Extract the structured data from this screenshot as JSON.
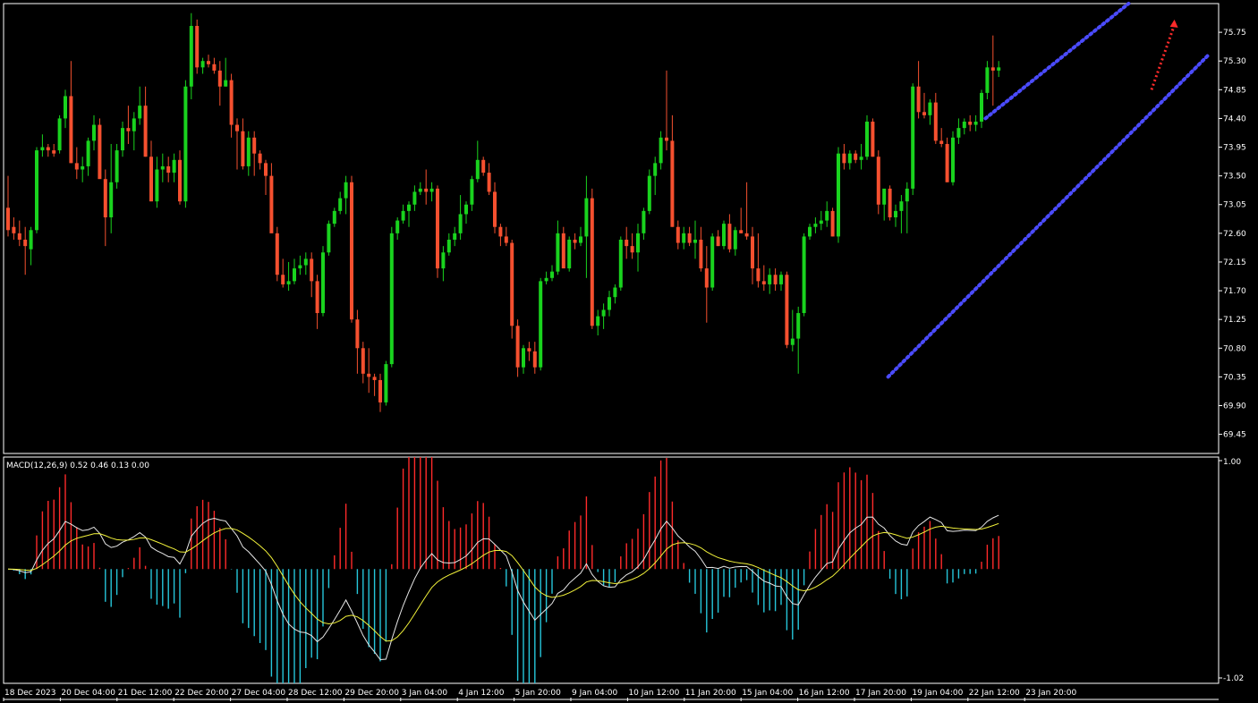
{
  "chart_data": {
    "type": "candlestick",
    "colors": {
      "background": "#000000",
      "frame": "#ffffff",
      "bull_candle": "#19d31e",
      "bear_candle": "#f5502f",
      "wick_bull": "#19d31e",
      "wick_bear": "#f5502f",
      "macd_hist_positive": "#ff2a2a",
      "macd_hist_negative": "#26c6da",
      "macd_line": "#e6e6e6",
      "signal_line": "#f2f23a",
      "channel_line": "#4b4bff",
      "arrow": "#ff2a2a"
    },
    "price_axis": {
      "ticks": [
        "75.75",
        "75.30",
        "74.85",
        "74.40",
        "73.95",
        "73.50",
        "73.05",
        "72.60",
        "72.15",
        "71.70",
        "71.25",
        "70.80",
        "70.35",
        "69.90",
        "69.45"
      ],
      "ylim": [
        69.15,
        76.2
      ]
    },
    "time_axis": {
      "labels": [
        "18 Dec 2023",
        "20 Dec 04:00",
        "21 Dec 12:00",
        "22 Dec 20:00",
        "27 Dec 04:00",
        "28 Dec 12:00",
        "29 Dec 20:00",
        "3 Jan 04:00",
        "4 Jan 12:00",
        "5 Jan 20:00",
        "9 Jan 04:00",
        "10 Jan 12:00",
        "11 Jan 20:00",
        "15 Jan 04:00",
        "16 Jan 12:00",
        "17 Jan 20:00",
        "19 Jan 04:00",
        "22 Jan 12:00",
        "23 Jan 20:00"
      ]
    },
    "candles": [
      [
        73.0,
        73.5,
        72.55,
        72.65
      ],
      [
        72.7,
        72.85,
        72.5,
        72.6
      ],
      [
        72.6,
        72.8,
        72.4,
        72.5
      ],
      [
        72.5,
        72.7,
        71.95,
        72.4
      ],
      [
        72.35,
        72.7,
        72.1,
        72.65
      ],
      [
        72.65,
        73.95,
        72.6,
        73.9
      ],
      [
        73.9,
        74.15,
        73.8,
        73.95
      ],
      [
        73.95,
        74.0,
        73.8,
        73.9
      ],
      [
        73.9,
        74.0,
        73.8,
        73.85
      ],
      [
        73.9,
        74.45,
        73.85,
        74.4
      ],
      [
        74.4,
        74.85,
        74.25,
        74.75
      ],
      [
        74.75,
        75.3,
        73.7,
        73.7
      ],
      [
        73.7,
        73.95,
        73.45,
        73.6
      ],
      [
        73.6,
        73.8,
        73.4,
        73.65
      ],
      [
        73.65,
        74.1,
        73.5,
        74.05
      ],
      [
        74.05,
        74.45,
        73.9,
        74.3
      ],
      [
        74.3,
        74.4,
        73.6,
        73.45
      ],
      [
        73.45,
        73.6,
        72.4,
        72.85
      ],
      [
        72.85,
        74.0,
        72.6,
        73.4
      ],
      [
        73.4,
        74.0,
        73.3,
        73.9
      ],
      [
        73.9,
        74.35,
        73.8,
        74.25
      ],
      [
        74.25,
        74.6,
        74.0,
        74.2
      ],
      [
        74.2,
        74.5,
        73.9,
        74.4
      ],
      [
        74.4,
        74.9,
        74.3,
        74.6
      ],
      [
        74.6,
        74.9,
        73.8,
        73.8
      ],
      [
        73.8,
        74.05,
        73.1,
        73.1
      ],
      [
        73.1,
        73.8,
        73.0,
        73.6
      ],
      [
        73.6,
        73.85,
        73.4,
        73.65
      ],
      [
        73.65,
        73.8,
        73.4,
        73.55
      ],
      [
        73.55,
        73.85,
        73.4,
        73.75
      ],
      [
        73.75,
        73.9,
        73.05,
        73.1
      ],
      [
        73.1,
        75.0,
        73.0,
        74.9
      ],
      [
        74.9,
        76.05,
        74.7,
        75.85
      ],
      [
        75.85,
        75.95,
        75.1,
        75.2
      ],
      [
        75.2,
        75.35,
        75.1,
        75.3
      ],
      [
        75.3,
        75.4,
        75.2,
        75.25
      ],
      [
        75.25,
        75.35,
        75.1,
        75.15
      ],
      [
        75.15,
        75.3,
        74.6,
        74.9
      ],
      [
        74.9,
        75.35,
        74.9,
        75.0
      ],
      [
        75.0,
        75.1,
        74.1,
        74.3
      ],
      [
        74.3,
        74.4,
        73.6,
        74.2
      ],
      [
        74.2,
        74.4,
        73.6,
        73.65
      ],
      [
        73.65,
        74.2,
        73.5,
        74.1
      ],
      [
        74.1,
        74.2,
        73.5,
        73.85
      ],
      [
        73.85,
        73.9,
        73.6,
        73.7
      ],
      [
        73.7,
        73.75,
        73.2,
        73.5
      ],
      [
        73.5,
        73.7,
        72.65,
        72.6
      ],
      [
        72.6,
        72.7,
        71.85,
        71.95
      ],
      [
        71.95,
        72.2,
        71.75,
        71.8
      ],
      [
        71.8,
        72.15,
        71.7,
        71.85
      ],
      [
        71.85,
        72.2,
        71.8,
        72.05
      ],
      [
        72.05,
        72.25,
        71.95,
        72.1
      ],
      [
        72.1,
        72.3,
        71.95,
        72.2
      ],
      [
        72.2,
        72.3,
        71.6,
        71.85
      ],
      [
        71.85,
        71.95,
        71.1,
        71.35
      ],
      [
        71.35,
        72.4,
        71.3,
        72.3
      ],
      [
        72.3,
        72.8,
        72.25,
        72.75
      ],
      [
        72.75,
        73.0,
        72.7,
        72.95
      ],
      [
        72.95,
        73.25,
        72.9,
        73.15
      ],
      [
        73.15,
        73.5,
        72.9,
        73.4
      ],
      [
        73.4,
        73.5,
        71.2,
        71.25
      ],
      [
        71.25,
        71.4,
        70.4,
        70.8
      ],
      [
        70.8,
        70.9,
        70.25,
        70.4
      ],
      [
        70.4,
        70.8,
        70.1,
        70.35
      ],
      [
        70.35,
        70.4,
        70.05,
        70.3
      ],
      [
        70.3,
        70.4,
        69.8,
        69.95
      ],
      [
        69.95,
        70.6,
        69.9,
        70.55
      ],
      [
        70.55,
        72.7,
        70.5,
        72.6
      ],
      [
        72.6,
        72.85,
        72.5,
        72.8
      ],
      [
        72.8,
        73.05,
        72.75,
        72.95
      ],
      [
        72.95,
        73.1,
        72.7,
        73.05
      ],
      [
        73.05,
        73.35,
        72.95,
        73.25
      ],
      [
        73.25,
        73.4,
        73.2,
        73.3
      ],
      [
        73.3,
        73.6,
        73.05,
        73.25
      ],
      [
        73.25,
        73.4,
        73.1,
        73.3
      ],
      [
        73.3,
        73.35,
        71.9,
        72.05
      ],
      [
        72.05,
        72.4,
        71.85,
        72.3
      ],
      [
        72.3,
        72.6,
        72.25,
        72.5
      ],
      [
        72.5,
        72.7,
        72.4,
        72.6
      ],
      [
        72.6,
        73.2,
        72.5,
        72.9
      ],
      [
        72.9,
        73.1,
        72.75,
        73.05
      ],
      [
        73.05,
        73.5,
        72.95,
        73.45
      ],
      [
        73.45,
        74.05,
        73.4,
        73.75
      ],
      [
        73.75,
        73.8,
        73.5,
        73.55
      ],
      [
        73.55,
        73.7,
        73.2,
        73.25
      ],
      [
        73.25,
        73.4,
        72.6,
        72.7
      ],
      [
        72.7,
        72.75,
        72.4,
        72.55
      ],
      [
        72.55,
        72.7,
        72.4,
        72.45
      ],
      [
        72.45,
        72.5,
        70.95,
        71.15
      ],
      [
        71.15,
        71.25,
        70.35,
        70.5
      ],
      [
        70.5,
        70.85,
        70.4,
        70.8
      ],
      [
        70.8,
        70.9,
        70.6,
        70.75
      ],
      [
        70.75,
        70.9,
        70.4,
        70.5
      ],
      [
        70.5,
        71.9,
        70.45,
        71.85
      ],
      [
        71.85,
        72.0,
        71.8,
        71.9
      ],
      [
        71.9,
        72.1,
        71.85,
        72.0
      ],
      [
        72.0,
        72.8,
        71.95,
        72.6
      ],
      [
        72.6,
        72.7,
        72.1,
        72.05
      ],
      [
        72.05,
        72.55,
        72.0,
        72.5
      ],
      [
        72.5,
        72.6,
        72.35,
        72.45
      ],
      [
        72.45,
        72.7,
        72.4,
        72.55
      ],
      [
        72.55,
        73.5,
        71.9,
        73.15
      ],
      [
        73.15,
        73.3,
        71.1,
        71.15
      ],
      [
        71.15,
        71.4,
        71.0,
        71.3
      ],
      [
        71.3,
        71.5,
        71.1,
        71.4
      ],
      [
        71.4,
        71.7,
        71.3,
        71.6
      ],
      [
        71.6,
        71.8,
        71.5,
        71.75
      ],
      [
        71.75,
        72.55,
        71.7,
        72.5
      ],
      [
        72.5,
        72.7,
        72.2,
        72.4
      ],
      [
        72.4,
        72.6,
        72.2,
        72.3
      ],
      [
        72.3,
        72.75,
        72.0,
        72.6
      ],
      [
        72.6,
        73.0,
        72.5,
        72.95
      ],
      [
        72.95,
        73.6,
        72.9,
        73.5
      ],
      [
        73.5,
        73.8,
        73.2,
        73.7
      ],
      [
        73.7,
        74.2,
        73.6,
        74.1
      ],
      [
        74.1,
        75.15,
        73.9,
        74.05
      ],
      [
        74.05,
        74.45,
        72.7,
        72.7
      ],
      [
        72.7,
        72.8,
        72.35,
        72.45
      ],
      [
        72.45,
        72.7,
        72.35,
        72.6
      ],
      [
        72.6,
        72.7,
        72.4,
        72.45
      ],
      [
        72.45,
        72.8,
        72.2,
        72.5
      ],
      [
        72.5,
        72.7,
        72.0,
        72.05
      ],
      [
        72.05,
        72.4,
        71.2,
        71.75
      ],
      [
        71.75,
        72.6,
        71.7,
        72.55
      ],
      [
        72.55,
        72.65,
        72.4,
        72.4
      ],
      [
        72.4,
        72.8,
        72.35,
        72.75
      ],
      [
        72.75,
        72.9,
        72.3,
        72.35
      ],
      [
        72.35,
        72.7,
        72.25,
        72.65
      ],
      [
        72.65,
        73.0,
        72.6,
        72.6
      ],
      [
        72.6,
        73.4,
        72.5,
        72.55
      ],
      [
        72.55,
        72.7,
        71.8,
        72.05
      ],
      [
        72.05,
        72.6,
        71.75,
        71.85
      ],
      [
        71.85,
        72.1,
        71.7,
        71.8
      ],
      [
        71.8,
        72.05,
        71.65,
        71.95
      ],
      [
        71.95,
        72.05,
        71.7,
        71.8
      ],
      [
        71.8,
        72.0,
        71.7,
        71.95
      ],
      [
        71.95,
        72.0,
        70.8,
        70.85
      ],
      [
        70.85,
        71.4,
        70.75,
        70.95
      ],
      [
        70.95,
        71.45,
        70.4,
        71.35
      ],
      [
        71.35,
        72.6,
        71.3,
        72.55
      ],
      [
        72.55,
        72.75,
        72.5,
        72.7
      ],
      [
        72.7,
        72.85,
        72.6,
        72.75
      ],
      [
        72.75,
        72.95,
        72.65,
        72.8
      ],
      [
        72.8,
        73.1,
        72.7,
        72.95
      ],
      [
        72.95,
        73.0,
        72.55,
        72.55
      ],
      [
        72.55,
        73.95,
        72.45,
        73.85
      ],
      [
        73.85,
        74.0,
        73.6,
        73.7
      ],
      [
        73.7,
        73.9,
        73.6,
        73.85
      ],
      [
        73.85,
        73.9,
        73.7,
        73.75
      ],
      [
        73.75,
        74.0,
        73.6,
        73.8
      ],
      [
        73.8,
        74.45,
        73.75,
        74.35
      ],
      [
        74.35,
        74.4,
        73.8,
        73.8
      ],
      [
        73.8,
        73.9,
        72.9,
        73.05
      ],
      [
        73.05,
        73.25,
        72.8,
        73.3
      ],
      [
        73.3,
        73.35,
        72.8,
        72.85
      ],
      [
        72.85,
        73.05,
        72.7,
        72.95
      ],
      [
        72.95,
        73.2,
        72.6,
        73.1
      ],
      [
        73.1,
        73.4,
        72.6,
        73.3
      ],
      [
        73.3,
        74.95,
        73.2,
        74.9
      ],
      [
        74.9,
        75.3,
        74.4,
        74.5
      ],
      [
        74.5,
        74.8,
        74.4,
        74.45
      ],
      [
        74.45,
        74.7,
        74.3,
        74.65
      ],
      [
        74.65,
        74.8,
        74.0,
        74.05
      ],
      [
        74.05,
        74.25,
        73.95,
        74.0
      ],
      [
        74.0,
        74.1,
        73.4,
        73.4
      ],
      [
        73.4,
        74.2,
        73.35,
        74.1
      ],
      [
        74.1,
        74.4,
        74.0,
        74.25
      ],
      [
        74.25,
        74.4,
        74.15,
        74.35
      ],
      [
        74.35,
        74.45,
        74.2,
        74.3
      ],
      [
        74.3,
        74.45,
        74.2,
        74.35
      ],
      [
        74.35,
        74.85,
        74.25,
        74.8
      ],
      [
        74.8,
        75.3,
        74.7,
        75.2
      ],
      [
        75.2,
        75.7,
        74.6,
        75.15
      ],
      [
        75.15,
        75.3,
        75.05,
        75.2
      ]
    ],
    "trend_channel": {
      "upper": {
        "from": {
          "bar": 171,
          "price": 74.4
        },
        "to": {
          "bar": 196,
          "price": 76.2
        }
      },
      "lower": {
        "from": {
          "bar": 154,
          "price": 70.35
        },
        "to": {
          "bar": 210,
          "price": 75.4
        }
      },
      "arrow": {
        "from": {
          "bar": 200,
          "price": 74.85
        },
        "to": {
          "bar": 204,
          "price": 75.95
        }
      }
    },
    "macd": {
      "label": "MACD(12,26,9) 0.52 0.46 0.13 0.00",
      "params": [
        12,
        26,
        9
      ],
      "values": {
        "macd": 0.52,
        "signal": 0.46,
        "hist": 0.13,
        "extra": 0.0
      },
      "scale_top_label": "1.00",
      "scale_bottom_label": "-1.02",
      "ylim": [
        -1.02,
        1.0
      ]
    }
  }
}
